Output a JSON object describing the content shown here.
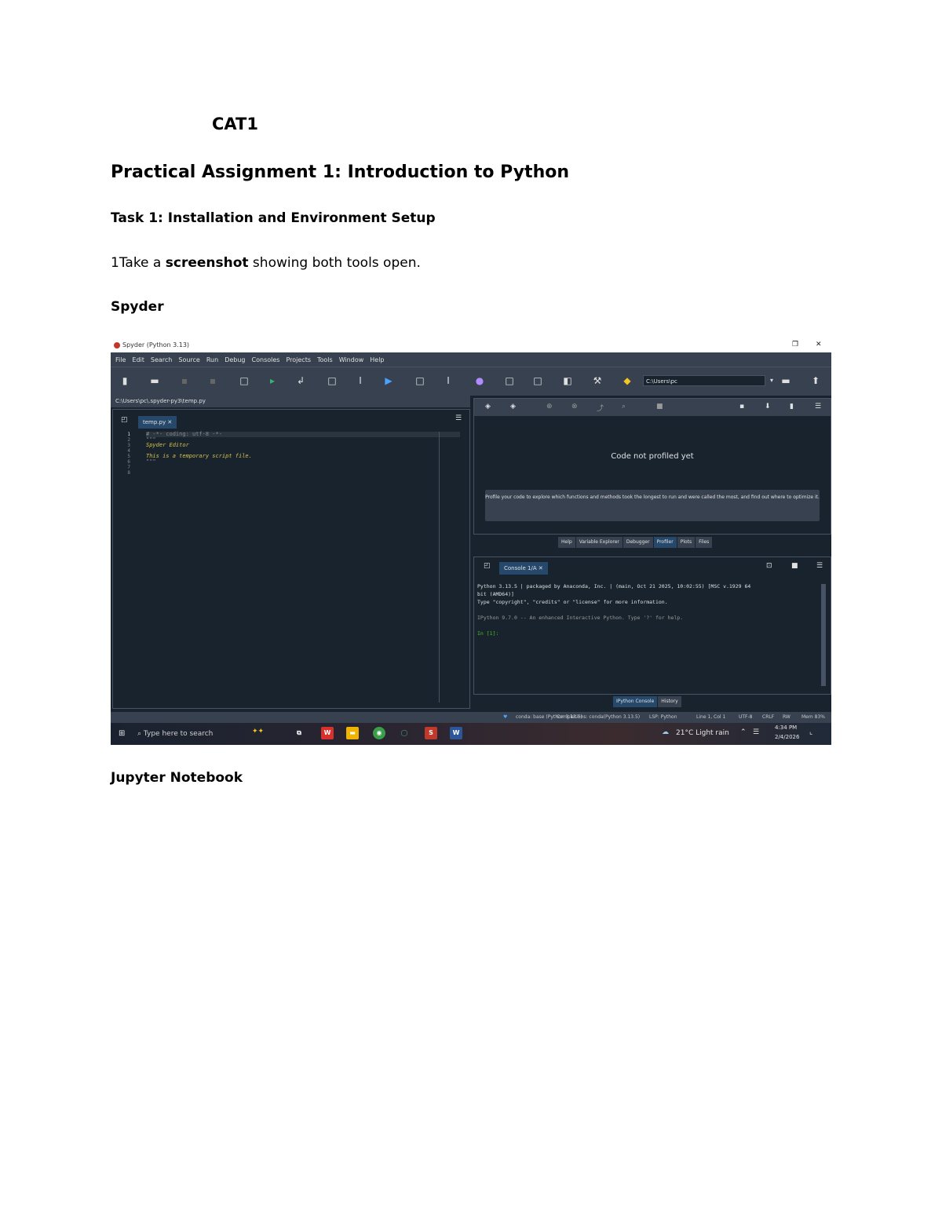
{
  "doc": {
    "cat": "CAT1",
    "title": "Practical Assignment 1: Introduction to Python",
    "task": "Task 1: Installation and Environment Setup",
    "instr_num": "1",
    "instr_a": "Take a ",
    "instr_bold": "screenshot",
    "instr_b": " showing both tools open.",
    "spyder_heading": "Spyder",
    "jupyter_heading": "Jupyter Notebook"
  },
  "spyder": {
    "window_title": "Spyder (Python 3.13)",
    "menu": [
      "File",
      "Edit",
      "Search",
      "Source",
      "Run",
      "Debug",
      "Consoles",
      "Projects",
      "Tools",
      "Window",
      "Help"
    ],
    "cwd": "C:\\Users\\pc",
    "file_path": "C:\\Users\\pc\\.spyder-py3\\temp.py",
    "editor_tab": "temp.py",
    "line_numbers": [
      "1",
      "2",
      "3",
      "4",
      "5",
      "6",
      "7",
      "8"
    ],
    "code_lines": [
      "# -*- coding: utf-8 -*-",
      "\"\"\"",
      "Spyder Editor",
      "",
      "This is a temporary script file.",
      "\"\"\"",
      "",
      ""
    ],
    "profiler_title": "Code not profiled yet",
    "profiler_hint": "Profile your code to explore which functions and methods took the longest to run and were called the most, and find out where to optimize it.",
    "top_tabs": [
      "Help",
      "Variable Explorer",
      "Debugger",
      "Profiler",
      "Plots",
      "Files"
    ],
    "top_active": "Profiler",
    "console_tab": "Console 1/A",
    "console_lines": [
      "Python 3.13.5 | packaged by Anaconda, Inc. | (main, Oct 21 2025, 10:02:55) [MSC v.1929 64",
      "bit (AMD64)]",
      "Type \"copyright\", \"credits\" or \"license\" for more information.",
      "",
      "IPython 9.7.0 -- An enhanced Interactive Python. Type '?' for help.",
      "",
      "In [1]:"
    ],
    "bottom_tabs": [
      "IPython Console",
      "History"
    ],
    "bottom_active": "IPython Console",
    "status": {
      "env": "conda: base (Python 3.13.5)",
      "completions": "Completions: conda(Python 3.13.5)",
      "lsp": "LSP: Python",
      "position": "Line 1, Col 1",
      "encoding": "UTF-8",
      "eol": "CRLF",
      "rw": "RW",
      "mem": "Mem 83%"
    }
  },
  "taskbar": {
    "search_placeholder": "Type here to search",
    "weather": "21°C  Light rain",
    "time": "4:34 PM",
    "date": "2/4/2026"
  }
}
